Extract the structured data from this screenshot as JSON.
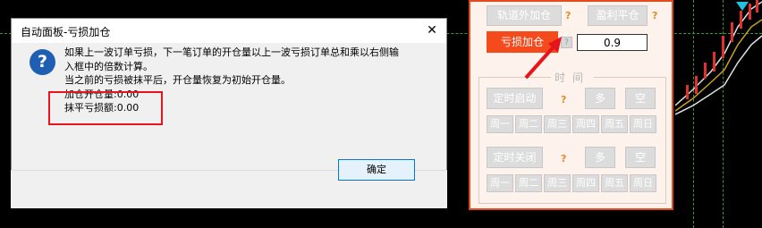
{
  "dialog": {
    "title": "自动面板-亏损加仓",
    "close_glyph": "✕",
    "icon_glyph": "?",
    "message_lines": [
      "如果上一波订单亏损，下一笔订单的开仓量以上一波亏损订单总和乘以右侧输",
      "入框中的倍数计算。",
      "当之前的亏损被抹平后，开仓量恢复为初始开仓量。",
      "加仓开仓量:0.00",
      "抹平亏损额:0.00"
    ],
    "ok_label": "确定"
  },
  "panel": {
    "btn_track_outside": "轨道外加仓",
    "btn_profit_close": "盈利平仓",
    "btn_loss_add": "亏损加仓",
    "multiplier_value": "0.9",
    "help_glyph": "?",
    "time_label": "时间",
    "timer_start": "定时启动",
    "timer_stop": "定时关闭",
    "long_label": "多",
    "short_label": "空",
    "weekdays": [
      "周一",
      "周二",
      "周三",
      "周四",
      "周五",
      "周日"
    ]
  },
  "colors": {
    "accent": "#f54a1c",
    "panel_border": "#e54a1d",
    "panel_bg": "#fdf3ec",
    "highlight_red": "#e8141b",
    "help_orange": "#e48a2a",
    "grid_green": "#3a9a3a"
  }
}
